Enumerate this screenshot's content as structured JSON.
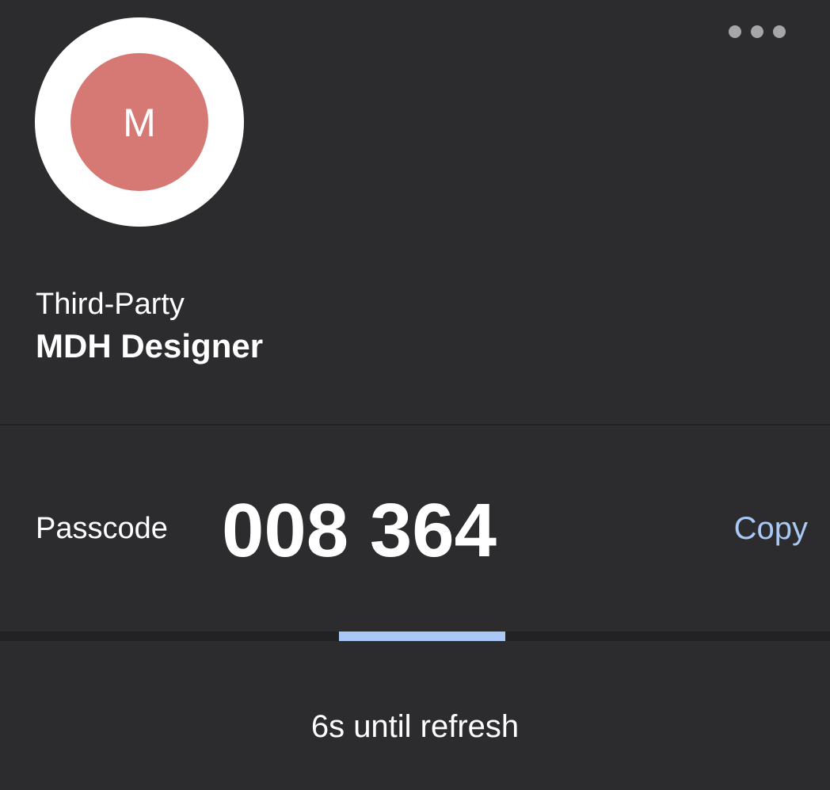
{
  "header": {
    "more_icon": "more-horizontal-icon"
  },
  "account": {
    "avatar_letter": "M",
    "avatar_color": "#d67873",
    "issuer": "Third-Party",
    "name": "MDH Designer"
  },
  "passcode": {
    "label": "Passcode",
    "value": "008 364",
    "copy_label": "Copy",
    "copy_color": "#a9c8f5"
  },
  "timer": {
    "progress_fraction": 0.2,
    "progress_color": "#a9c8f5",
    "refresh_text": "6s until refresh"
  }
}
